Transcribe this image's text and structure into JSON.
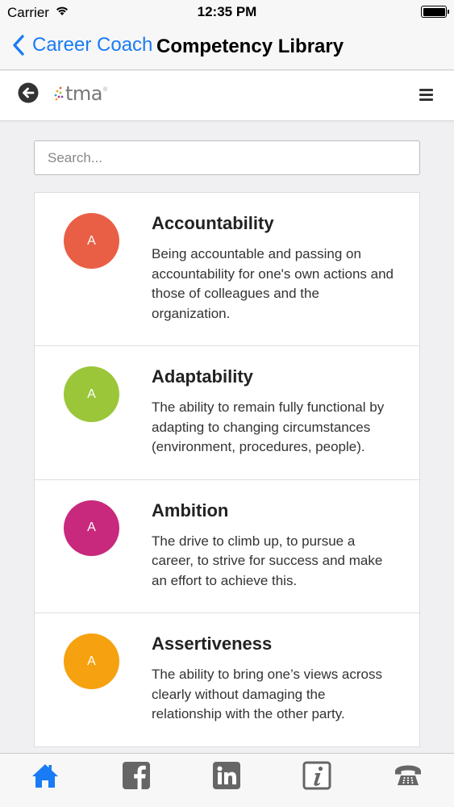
{
  "status": {
    "carrier": "Carrier",
    "time": "12:35 PM"
  },
  "nav": {
    "back_label": "Career Coach",
    "title": "Competency Library"
  },
  "header": {
    "logo_text": "tma",
    "logo_mark": "®"
  },
  "search": {
    "placeholder": "Search..."
  },
  "competencies": [
    {
      "initial": "A",
      "name": "Accountability",
      "description": "Being accountable and passing on accountability for one's own actions and those of colleagues and the organization.",
      "color": "#e95f45"
    },
    {
      "initial": "A",
      "name": "Adaptability",
      "description": "The ability to remain fully functional by adapting to changing circumstances (environment, procedures, people).",
      "color": "#9bc63a"
    },
    {
      "initial": "A",
      "name": "Ambition",
      "description": "The drive to climb up, to pursue a career, to strive for success and make an effort to achieve this.",
      "color": "#c8297d"
    },
    {
      "initial": "A",
      "name": "Assertiveness",
      "description": "The ability to bring one’s views across clearly without damaging the relationship with the other party.",
      "color": "#f6a10f"
    }
  ],
  "tabs": [
    {
      "icon": "home-icon",
      "active": true
    },
    {
      "icon": "facebook-icon",
      "active": false
    },
    {
      "icon": "linkedin-icon",
      "active": false
    },
    {
      "icon": "info-icon",
      "active": false
    },
    {
      "icon": "phone-icon",
      "active": false
    }
  ],
  "colors": {
    "accent": "#1a7cf5",
    "tab_inactive": "#666666"
  }
}
